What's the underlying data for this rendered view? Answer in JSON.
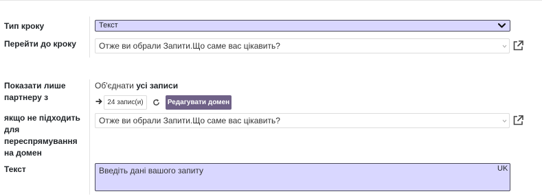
{
  "fields": {
    "step_type": {
      "label": "Тип кроку",
      "value": "Текст"
    },
    "goto_step": {
      "label": "Перейти до кроку",
      "value": "Отже ви обрали Запити.Що саме вас цікавить?"
    },
    "show_partner": {
      "label_line1": "Показати лише",
      "label_line2": "партнеру з",
      "domain_prefix": "Об'єднати",
      "domain_value": "усі записи",
      "record_count": "24 запис(и)",
      "edit_domain_label": "Редагувати домен"
    },
    "no_match": {
      "label_line1": "якщо не підходить",
      "label_line2": "для",
      "label_line3": "переспрямування",
      "label_line4": "на домен",
      "value": "Отже ви обрали Запити.Що саме вас цікавить?"
    },
    "text": {
      "label": "Текст",
      "placeholder": "Введіть дані вашого запиту",
      "lang": "UK"
    }
  },
  "icons": {
    "dropdown": "chevron-down-icon",
    "external_link": "external-link-icon",
    "arrow": "arrow-right-icon",
    "refresh": "refresh-icon"
  },
  "colors": {
    "required_field_bg": "#d9d7ff",
    "button_bg": "#6f6187"
  }
}
